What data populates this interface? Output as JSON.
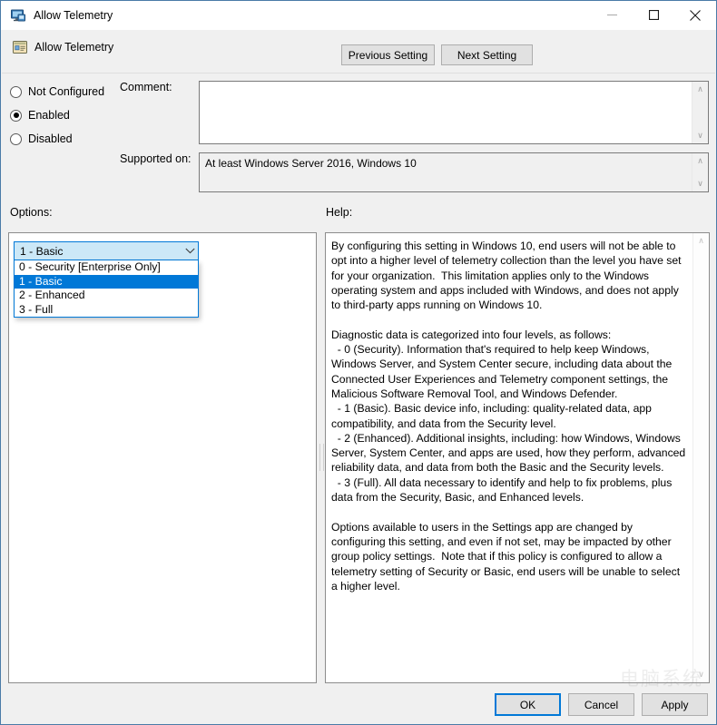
{
  "window": {
    "title": "Allow Telemetry",
    "icon": "policy-monitor-icon",
    "minimize_label": "—",
    "maximize_label": "□",
    "close_label": "✕"
  },
  "header": {
    "title": "Allow Telemetry",
    "icon": "policy-setting-icon",
    "previous_button": "Previous Setting",
    "next_button": "Next Setting"
  },
  "state": {
    "options": [
      {
        "label": "Not Configured",
        "checked": false
      },
      {
        "label": "Enabled",
        "checked": true
      },
      {
        "label": "Disabled",
        "checked": false
      }
    ]
  },
  "fields": {
    "comment_label": "Comment:",
    "comment_value": "",
    "supported_label": "Supported on:",
    "supported_value": "At least Windows Server 2016, Windows 10"
  },
  "sections": {
    "options_label": "Options:",
    "help_label": "Help:"
  },
  "combo": {
    "selected": "1 - Basic",
    "expanded": true,
    "arrow_icon": "chevron-down-icon",
    "items": [
      {
        "label": "0 - Security [Enterprise Only]",
        "selected": false
      },
      {
        "label": "1 - Basic",
        "selected": true
      },
      {
        "label": "2 - Enhanced",
        "selected": false
      },
      {
        "label": "3 - Full",
        "selected": false
      }
    ]
  },
  "help": {
    "text": "By configuring this setting in Windows 10, end users will not be able to opt into a higher level of telemetry collection than the level you have set for your organization.  This limitation applies only to the Windows operating system and apps included with Windows, and does not apply to third-party apps running on Windows 10.\n\nDiagnostic data is categorized into four levels, as follows:\n  - 0 (Security). Information that's required to help keep Windows, Windows Server, and System Center secure, including data about the Connected User Experiences and Telemetry component settings, the Malicious Software Removal Tool, and Windows Defender.\n  - 1 (Basic). Basic device info, including: quality-related data, app compatibility, and data from the Security level.\n  - 2 (Enhanced). Additional insights, including: how Windows, Windows Server, System Center, and apps are used, how they perform, advanced reliability data, and data from both the Basic and the Security levels.\n  - 3 (Full). All data necessary to identify and help to fix problems, plus data from the Security, Basic, and Enhanced levels.\n\nOptions available to users in the Settings app are changed by configuring this setting, and even if not set, may be impacted by other group policy settings.  Note that if this policy is configured to allow a telemetry setting of Security or Basic, end users will be unable to select a higher level."
  },
  "footer": {
    "ok": "OK",
    "cancel": "Cancel",
    "apply": "Apply"
  },
  "scrollbars": {
    "up_arrow": "∧",
    "down_arrow": "∨"
  },
  "watermark": "电脑系统",
  "colors": {
    "accent": "#0078d7",
    "combo_fill": "#cce8f7",
    "window_bg": "#f0f0f0",
    "border": "#4a7ba7"
  }
}
